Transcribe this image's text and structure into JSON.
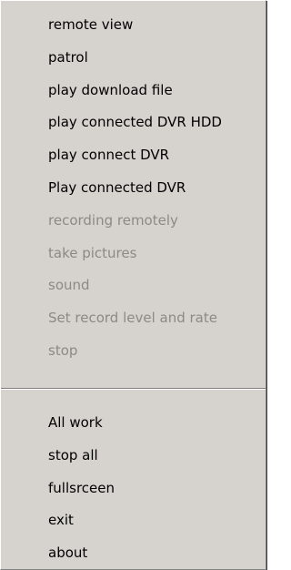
{
  "menu": {
    "top_items": [
      {
        "label": "remote view",
        "enabled": true
      },
      {
        "label": "patrol",
        "enabled": true
      },
      {
        "label": "play download file",
        "enabled": true
      },
      {
        "label": "play connected DVR HDD",
        "enabled": true
      },
      {
        "label": "play connect DVR",
        "enabled": true
      },
      {
        "label": "Play connected DVR",
        "enabled": true
      },
      {
        "label": "recording remotely",
        "enabled": false
      },
      {
        "label": "take pictures",
        "enabled": false
      },
      {
        "label": "sound",
        "enabled": false
      },
      {
        "label": "Set record level and rate",
        "enabled": false
      },
      {
        "label": "stop",
        "enabled": false
      }
    ],
    "bottom_items": [
      {
        "label": "All work",
        "enabled": true
      },
      {
        "label": "stop all",
        "enabled": true
      },
      {
        "label": "fullsrceen",
        "enabled": true
      },
      {
        "label": "exit",
        "enabled": true
      },
      {
        "label": "about",
        "enabled": true
      }
    ]
  }
}
